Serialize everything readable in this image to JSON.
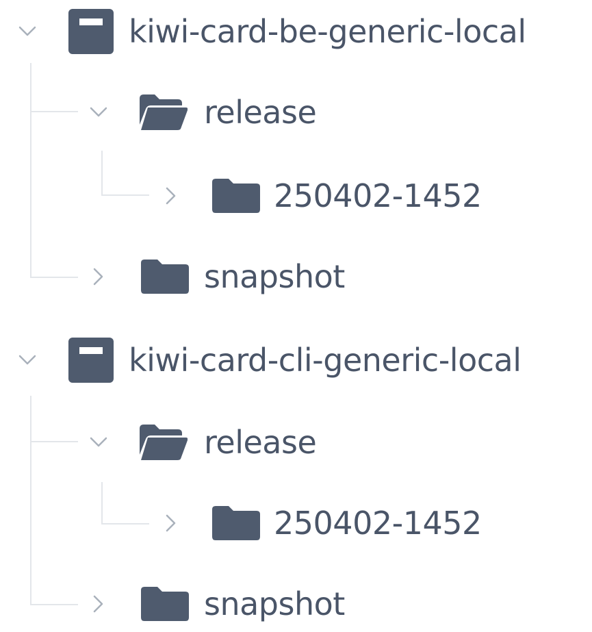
{
  "colors": {
    "text": "#4a5568",
    "icon": "#4f5b6e",
    "chevron": "#a9b1bb",
    "guide": "#e3e6ea"
  },
  "tree": [
    {
      "label": "kiwi-card-be-generic-local",
      "icon": "repository-icon",
      "expanded": true,
      "children": [
        {
          "label": "release",
          "icon": "folder-open-icon",
          "expanded": true,
          "children": [
            {
              "label": "250402-1452",
              "icon": "folder-icon",
              "expanded": false
            }
          ]
        },
        {
          "label": "snapshot",
          "icon": "folder-icon",
          "expanded": false
        }
      ]
    },
    {
      "label": "kiwi-card-cli-generic-local",
      "icon": "repository-icon",
      "expanded": true,
      "children": [
        {
          "label": "release",
          "icon": "folder-open-icon",
          "expanded": true,
          "children": [
            {
              "label": "250402-1452",
              "icon": "folder-icon",
              "expanded": false
            }
          ]
        },
        {
          "label": "snapshot",
          "icon": "folder-icon",
          "expanded": false
        }
      ]
    }
  ]
}
